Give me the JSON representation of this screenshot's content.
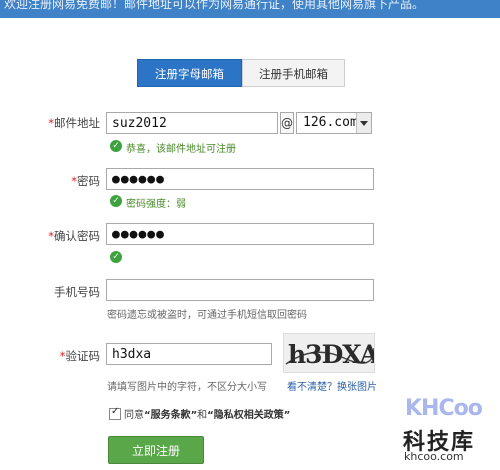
{
  "banner": {
    "text": "欢迎注册网易免费邮！邮件地址可以作为网易通行证，使用其他网易旗下产品。"
  },
  "tabs": [
    {
      "label": "注册字母邮箱",
      "active": true
    },
    {
      "label": "注册手机邮箱",
      "active": false
    }
  ],
  "email": {
    "label": "邮件地址",
    "value": "suz2012",
    "at_sign": "@",
    "domain": "126.com",
    "ok_text": "恭喜，该邮件地址可注册"
  },
  "password": {
    "label": "密码",
    "value": "●●●●●●",
    "ok_text": "密码强度：弱"
  },
  "confirm_password": {
    "label": "确认密码",
    "value": "●●●●●●"
  },
  "phone": {
    "label": "手机号码",
    "value": "",
    "hint": "密码遗忘或被盗时，可通过手机短信取回密码"
  },
  "captcha": {
    "label": "验证码",
    "value": "h3dxa",
    "image_text": "h3DXA",
    "hint": "请填写图片中的字符，不区分大小写",
    "refresh_link": "看不清楚？换张图片"
  },
  "agreement": {
    "checked": true,
    "prefix": "同意",
    "terms": "“服务条款”",
    "and": "和",
    "privacy": "“隐私权相关政策”"
  },
  "submit_label": "立即注册",
  "watermark": {
    "brand": "KHCoo",
    "name_cn": "科技库",
    "url": "khcoo.com"
  },
  "colors": {
    "tab_active": "#2b74c6",
    "submit": "#5aa74a",
    "ok": "#3da23d",
    "required_star": "#dd2222"
  }
}
